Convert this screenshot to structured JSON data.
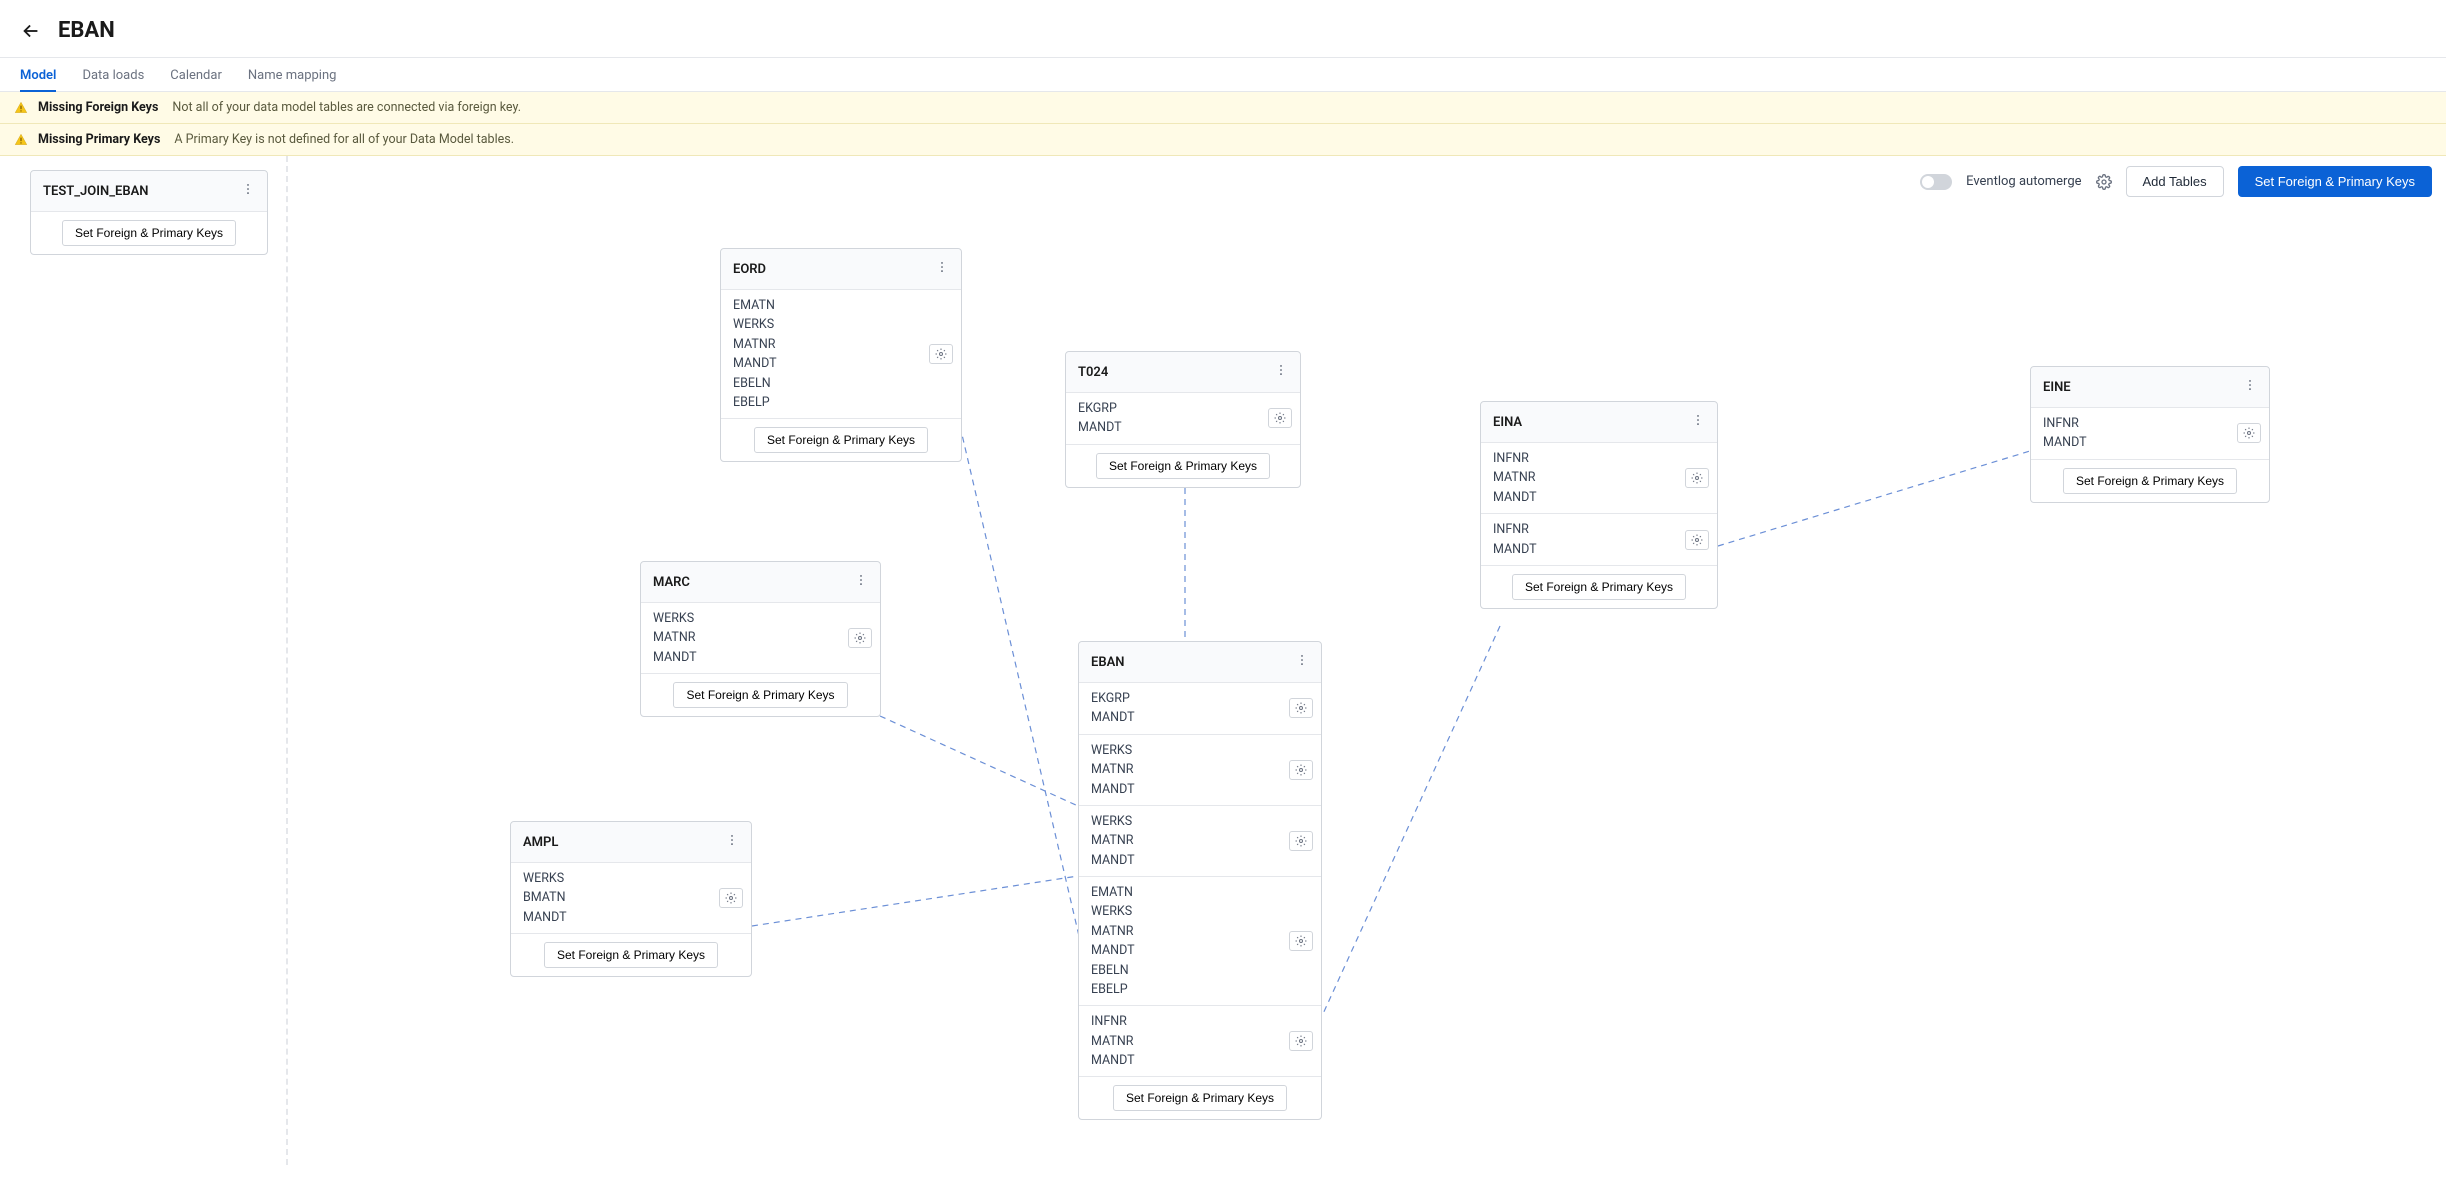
{
  "header": {
    "title": "EBAN"
  },
  "tabs": [
    {
      "id": "model",
      "label": "Model",
      "active": true
    },
    {
      "id": "data-loads",
      "label": "Data loads",
      "active": false
    },
    {
      "id": "calendar",
      "label": "Calendar",
      "active": false
    },
    {
      "id": "name-mapping",
      "label": "Name mapping",
      "active": false
    }
  ],
  "warnings": [
    {
      "title": "Missing Foreign Keys",
      "message": "Not all of your data model tables are connected via foreign key."
    },
    {
      "title": "Missing Primary Keys",
      "message": "A Primary Key is not defined for all of your Data Model tables."
    }
  ],
  "toolbar": {
    "automerge_label": "Eventlog automerge",
    "add_tables_label": "Add Tables",
    "set_keys_label": "Set Foreign & Primary Keys"
  },
  "buttons": {
    "set_fk_pk": "Set Foreign & Primary Keys"
  },
  "nodes": {
    "test_join_eban": {
      "name": "TEST_JOIN_EBAN",
      "groups": []
    },
    "eord": {
      "name": "EORD",
      "groups": [
        {
          "cols": [
            "EMATN",
            "WERKS",
            "MATNR",
            "MANDT",
            "EBELN",
            "EBELP"
          ],
          "gear": true
        }
      ]
    },
    "t024": {
      "name": "T024",
      "groups": [
        {
          "cols": [
            "EKGRP",
            "MANDT"
          ],
          "gear": true
        }
      ]
    },
    "eina": {
      "name": "EINA",
      "groups": [
        {
          "cols": [
            "INFNR",
            "MATNR",
            "MANDT"
          ],
          "gear": true
        },
        {
          "cols": [
            "INFNR",
            "MANDT"
          ],
          "gear": true
        }
      ]
    },
    "eine": {
      "name": "EINE",
      "groups": [
        {
          "cols": [
            "INFNR",
            "MANDT"
          ],
          "gear": true
        }
      ]
    },
    "marc": {
      "name": "MARC",
      "groups": [
        {
          "cols": [
            "WERKS",
            "MATNR",
            "MANDT"
          ],
          "gear": true
        }
      ]
    },
    "ampl": {
      "name": "AMPL",
      "groups": [
        {
          "cols": [
            "WERKS",
            "BMATN",
            "MANDT"
          ],
          "gear": true
        }
      ]
    },
    "eban": {
      "name": "EBAN",
      "groups": [
        {
          "cols": [
            "EKGRP",
            "MANDT"
          ],
          "gear": true
        },
        {
          "cols": [
            "WERKS",
            "MATNR",
            "MANDT"
          ],
          "gear": true
        },
        {
          "cols": [
            "WERKS",
            "MATNR",
            "MANDT"
          ],
          "gear": true
        },
        {
          "cols": [
            "EMATN",
            "WERKS",
            "MATNR",
            "MANDT",
            "EBELN",
            "EBELP"
          ],
          "gear": true
        },
        {
          "cols": [
            "INFNR",
            "MATNR",
            "MANDT"
          ],
          "gear": true
        }
      ]
    }
  }
}
